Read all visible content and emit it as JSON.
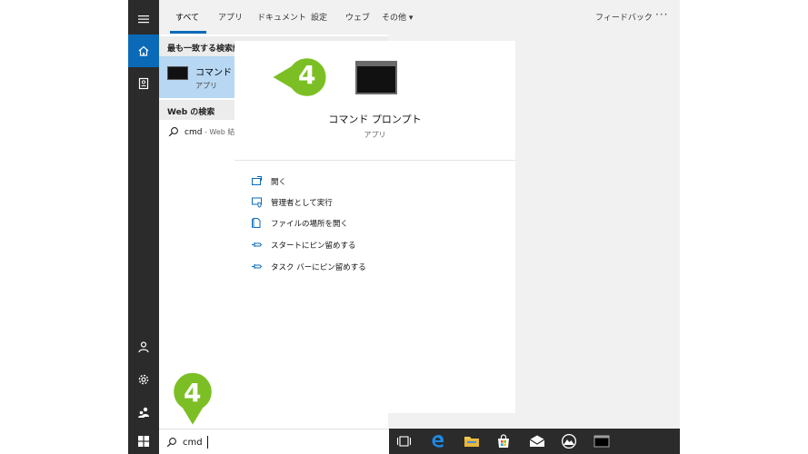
{
  "tabs": [
    {
      "label": "すべて",
      "active": true
    },
    {
      "label": "アプリ"
    },
    {
      "label": "ドキュメント"
    },
    {
      "label": "設定"
    },
    {
      "label": "ウェブ"
    },
    {
      "label": "その他 ▾"
    }
  ],
  "feedback_label": "フィードバック",
  "more_label": "···",
  "results": {
    "best_match_heading": "最も一致する検索結果",
    "best_match": {
      "title": "コマンド プロンプト",
      "subtitle": "アプリ"
    },
    "web_heading": "Web の検索",
    "web_query": "cmd",
    "web_hint": " - Web 結果を見る"
  },
  "detail": {
    "title": "コマンド プロンプト",
    "subtitle": "アプリ",
    "actions": [
      {
        "label": "開く",
        "icon": "open-icon"
      },
      {
        "label": "管理者として実行",
        "icon": "run-as-admin-icon"
      },
      {
        "label": "ファイルの場所を開く",
        "icon": "file-location-icon"
      },
      {
        "label": "スタートにピン留めする",
        "icon": "pin-icon"
      },
      {
        "label": "タスク バーにピン留めする",
        "icon": "pin-icon"
      }
    ]
  },
  "search": {
    "value": "cmd"
  },
  "callouts": {
    "top": "4",
    "bottom": "4"
  },
  "colors": {
    "accent": "#0b6ab8",
    "highlight": "#b7d7f2",
    "callout": "#7cbf24",
    "dark": "#2b2b2b"
  }
}
